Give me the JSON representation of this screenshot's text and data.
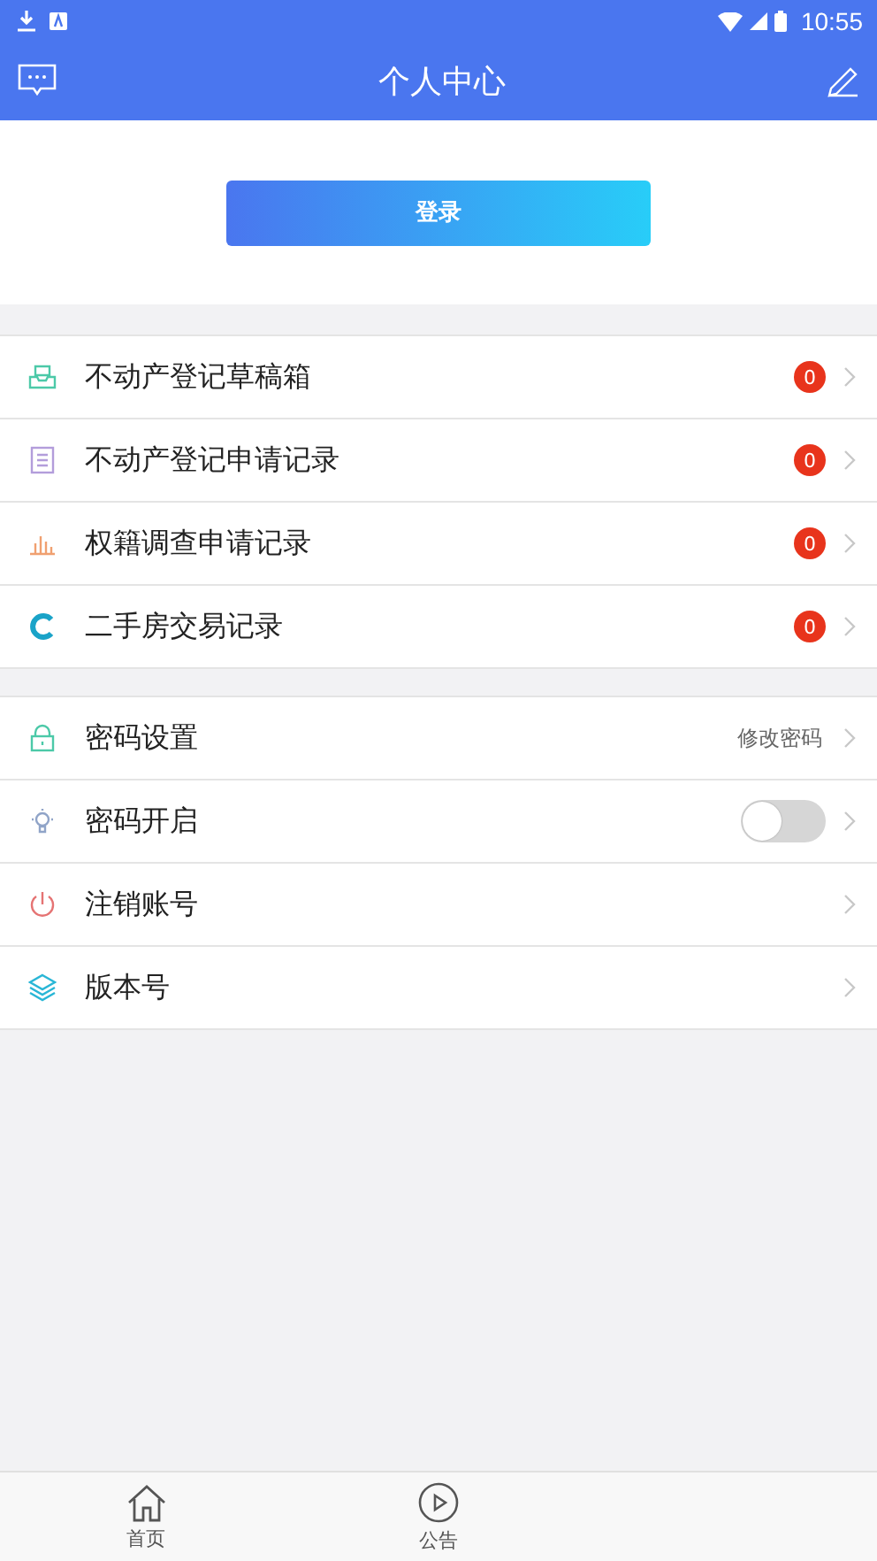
{
  "status_bar": {
    "time": "10:55"
  },
  "header": {
    "title": "个人中心"
  },
  "login_button": "登录",
  "groups": [
    {
      "items": [
        {
          "label": "不动产登记草稿箱",
          "kind": "badge",
          "badge": "0"
        },
        {
          "label": "不动产登记申请记录",
          "kind": "badge",
          "badge": "0"
        },
        {
          "label": "权籍调查申请记录",
          "kind": "badge",
          "badge": "0"
        },
        {
          "label": "二手房交易记录",
          "kind": "badge",
          "badge": "0"
        }
      ]
    },
    {
      "items": [
        {
          "label": "密码设置",
          "kind": "text",
          "value": "修改密码"
        },
        {
          "label": "密码开启",
          "kind": "toggle",
          "on": false
        },
        {
          "label": "注销账号",
          "kind": "plain"
        },
        {
          "label": "版本号",
          "kind": "plain"
        }
      ]
    }
  ],
  "tab_bar": [
    {
      "label": "首页"
    },
    {
      "label": "公告"
    }
  ]
}
